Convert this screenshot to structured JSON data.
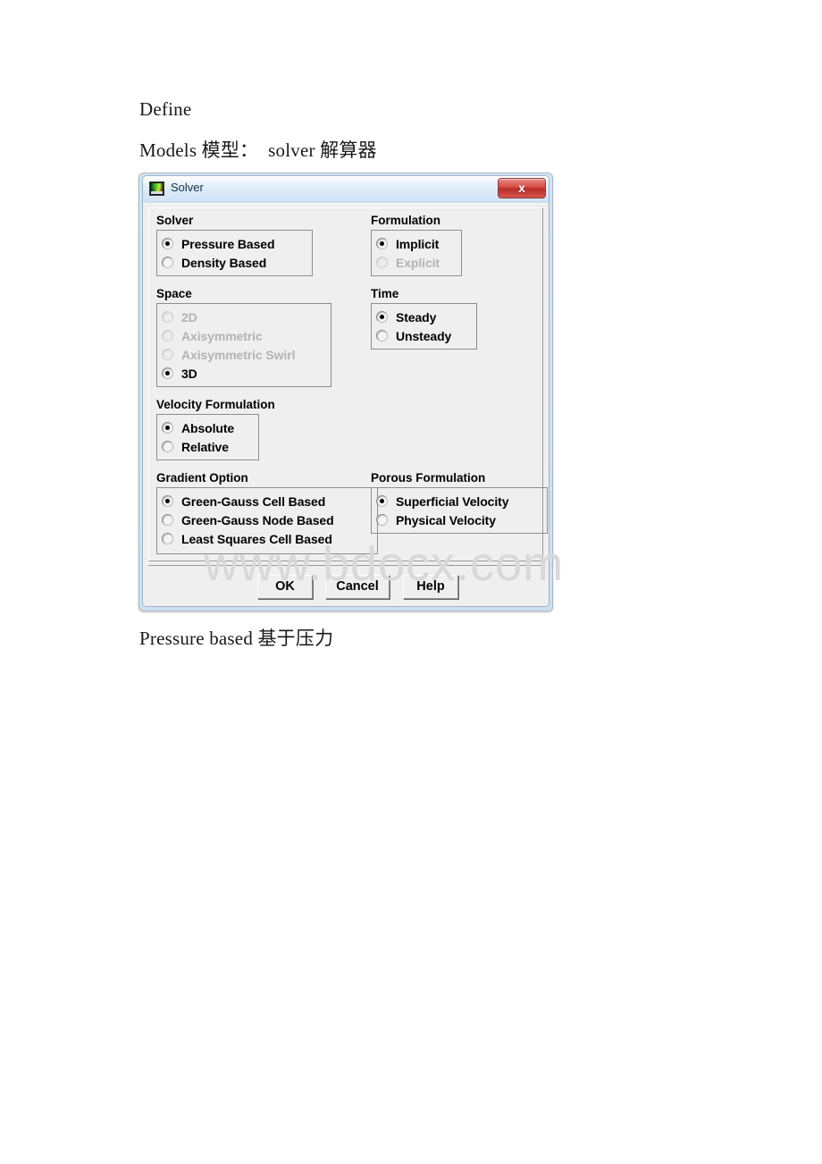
{
  "document": {
    "line1": "Define",
    "line2": "Models 模型：  solver 解算器",
    "caption": "Pressure based 基于压力"
  },
  "watermark": {
    "text": "www.bdocx.com"
  },
  "dialog": {
    "title": "Solver",
    "icon": "fluent-solver-icon",
    "close_label": "x",
    "groups": [
      {
        "key": "solver",
        "label": "Solver",
        "options": [
          {
            "label": "Pressure Based",
            "selected": true,
            "disabled": false
          },
          {
            "label": "Density Based",
            "selected": false,
            "disabled": false
          }
        ]
      },
      {
        "key": "formulation",
        "label": "Formulation",
        "options": [
          {
            "label": "Implicit",
            "selected": true,
            "disabled": false
          },
          {
            "label": "Explicit",
            "selected": false,
            "disabled": true
          }
        ]
      },
      {
        "key": "space",
        "label": "Space",
        "options": [
          {
            "label": "2D",
            "selected": false,
            "disabled": true
          },
          {
            "label": "Axisymmetric",
            "selected": false,
            "disabled": true
          },
          {
            "label": "Axisymmetric Swirl",
            "selected": false,
            "disabled": true
          },
          {
            "label": "3D",
            "selected": true,
            "disabled": false
          }
        ]
      },
      {
        "key": "time",
        "label": "Time",
        "options": [
          {
            "label": "Steady",
            "selected": true,
            "disabled": false
          },
          {
            "label": "Unsteady",
            "selected": false,
            "disabled": false
          }
        ]
      },
      {
        "key": "velocity",
        "label": "Velocity Formulation",
        "options": [
          {
            "label": "Absolute",
            "selected": true,
            "disabled": false
          },
          {
            "label": "Relative",
            "selected": false,
            "disabled": false
          }
        ]
      },
      {
        "key": "gradient",
        "label": "Gradient Option",
        "options": [
          {
            "label": "Green-Gauss Cell Based",
            "selected": true,
            "disabled": false
          },
          {
            "label": "Green-Gauss Node Based",
            "selected": false,
            "disabled": false
          },
          {
            "label": "Least Squares Cell Based",
            "selected": false,
            "disabled": false
          }
        ]
      },
      {
        "key": "porous",
        "label": "Porous Formulation",
        "options": [
          {
            "label": "Superficial Velocity",
            "selected": true,
            "disabled": false
          },
          {
            "label": "Physical Velocity",
            "selected": false,
            "disabled": false
          }
        ]
      }
    ],
    "buttons": {
      "ok": "OK",
      "cancel": "Cancel",
      "help": "Help"
    }
  },
  "colors": {
    "titlebar_accent": "#cfe2f6",
    "close_button": "#b92f28",
    "dialog_face": "#efefef",
    "disabled_text": "#b3b3b3"
  }
}
